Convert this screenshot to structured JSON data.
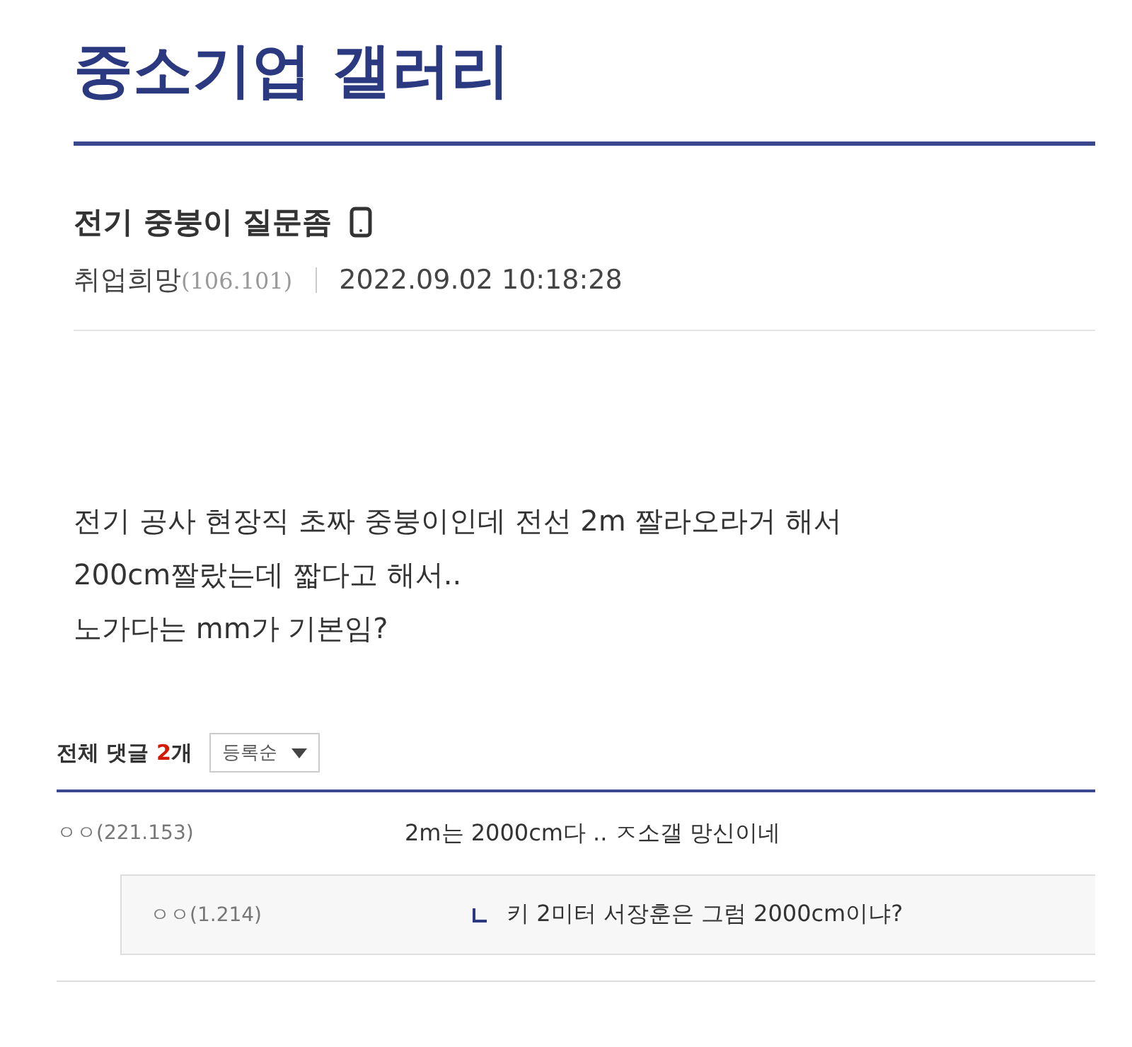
{
  "gallery_title": "중소기업 갤러리",
  "post": {
    "title": "전기 중붕이 질문좀",
    "author": "취업희망",
    "author_ip": "(106.101)",
    "date": "2022.09.02 10:18:28",
    "body": [
      "전기 공사 현장직 초짜 중붕이인데 전선 2m 짤라오라거 해서",
      "200cm짤랐는데 짧다고 해서..",
      "노가다는 mm가 기본임?"
    ]
  },
  "comments_header": {
    "label": "전체 댓글",
    "count": "2",
    "unit": "개",
    "sort": "등록순"
  },
  "comments": [
    {
      "author": "ㅇㅇ",
      "ip": "(221.153)",
      "text": "2m는 2000cm다 .. ㅈ소갤 망신이네",
      "replies": [
        {
          "author": "ㅇㅇ",
          "ip": "(1.214)",
          "text": "키 2미터 서장훈은 그럼 2000cm이냐?"
        }
      ]
    }
  ]
}
